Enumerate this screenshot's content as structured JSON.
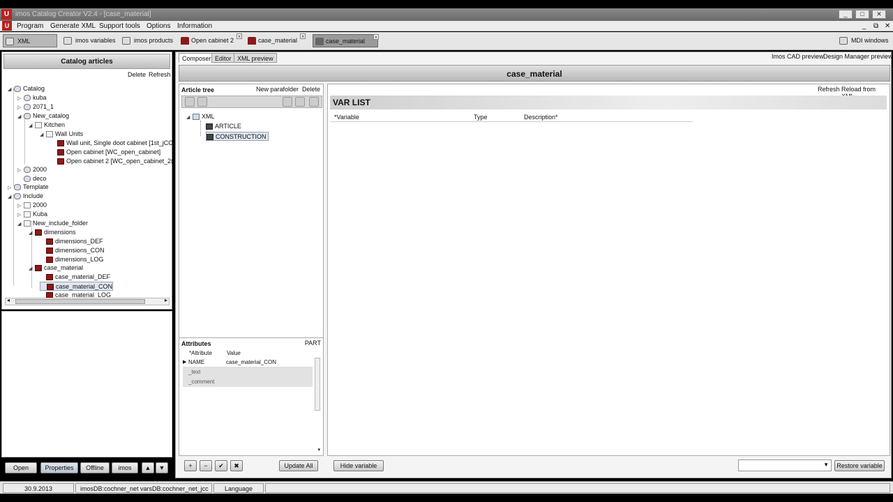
{
  "window": {
    "title": "imos Catalog Creator V2.4 - [case_material]",
    "app_icon": "U",
    "controls": [
      "_",
      "□",
      "✕"
    ]
  },
  "menu": {
    "items": [
      "Program",
      "Generate XML",
      "Support tools",
      "Options",
      "Information"
    ],
    "window_controls": [
      "_",
      "⧉",
      "✕"
    ]
  },
  "toolbar": {
    "buttons": [
      "XML Catalog",
      "imos variables",
      "imos products"
    ],
    "doc_tabs": [
      "Open cabinet 2",
      "case_material",
      "case_material"
    ],
    "mdi_label": "MDI windows"
  },
  "left": {
    "header": "Catalog articles",
    "delete": "Delete",
    "refresh": "Refresh",
    "tree": [
      {
        "label": "Catalog",
        "exp": "◢"
      },
      {
        "label": "kuba",
        "exp": "▷"
      },
      {
        "label": "2071_1",
        "exp": "▷"
      },
      {
        "label": "New_catalog",
        "exp": "◢"
      },
      {
        "label": "Kitchen",
        "exp": "◢"
      },
      {
        "label": "Wall Units",
        "exp": "◢"
      },
      {
        "label": "Wall unit, Single doot cabinet [1st_jCC",
        "exp": ""
      },
      {
        "label": "Open cabinet [WC_open_cabinet]",
        "exp": ""
      },
      {
        "label": "Open cabinet 2 [WC_open_cabinet_2(",
        "exp": ""
      },
      {
        "label": "2000",
        "exp": "▷"
      },
      {
        "label": "deco",
        "exp": ""
      },
      {
        "label": "Template",
        "exp": "▷"
      },
      {
        "label": "Include",
        "exp": "◢"
      },
      {
        "label": "2000",
        "exp": "▷"
      },
      {
        "label": "Kuba",
        "exp": "▷"
      },
      {
        "label": "New_include_folder",
        "exp": "◢"
      },
      {
        "label": "dimensions",
        "exp": "◢"
      },
      {
        "label": "dimensions_DEF",
        "exp": ""
      },
      {
        "label": "dimensions_CON",
        "exp": ""
      },
      {
        "label": "dimensions_LOG",
        "exp": ""
      },
      {
        "label": "case_material",
        "exp": "◢"
      },
      {
        "label": "case_material_DEF",
        "exp": ""
      },
      {
        "label": "case_material_CON",
        "exp": ""
      },
      {
        "label": "case_material_LOG",
        "exp": ""
      }
    ],
    "bottom_buttons": [
      "Open",
      "Properties",
      "Offline",
      "imos",
      "▲",
      "▼"
    ]
  },
  "main": {
    "subtabs": [
      "Composer",
      "Editor",
      "XML preview"
    ],
    "right_links": [
      "Imos CAD preview",
      "Design Manager preview"
    ],
    "doc_title": "case_material",
    "article_tree": {
      "title": "Article tree",
      "new_parafolder": "New parafolder",
      "delete": "Delete",
      "nodes": [
        "XML",
        "ARTICLE",
        "CONSTRUCTION"
      ]
    },
    "attributes": {
      "title": "Attributes",
      "tag": "PART",
      "col_attribute": "*Attribute",
      "col_value": "Value",
      "rows": [
        {
          "name": "NAME",
          "value": "case_material_CON"
        },
        {
          "name": "_text",
          "value": ""
        },
        {
          "name": "_comment",
          "value": ""
        }
      ],
      "update_all": "Update All",
      "tools": [
        "+",
        "−",
        "✔",
        "✖"
      ]
    },
    "varlist": {
      "refresh": "Refresh",
      "reload": "Reload from XML",
      "title": "VAR LIST",
      "col_variable": "*Variable",
      "col_type": "Type",
      "col_description": "Description*",
      "hide_variable": "Hide variable",
      "restore_variable": "Restore variable"
    }
  },
  "status": {
    "date": "30.9.2013",
    "db": "imosDB:cochner_net   varsDB:cochner_net_jcc",
    "language": "Language"
  }
}
